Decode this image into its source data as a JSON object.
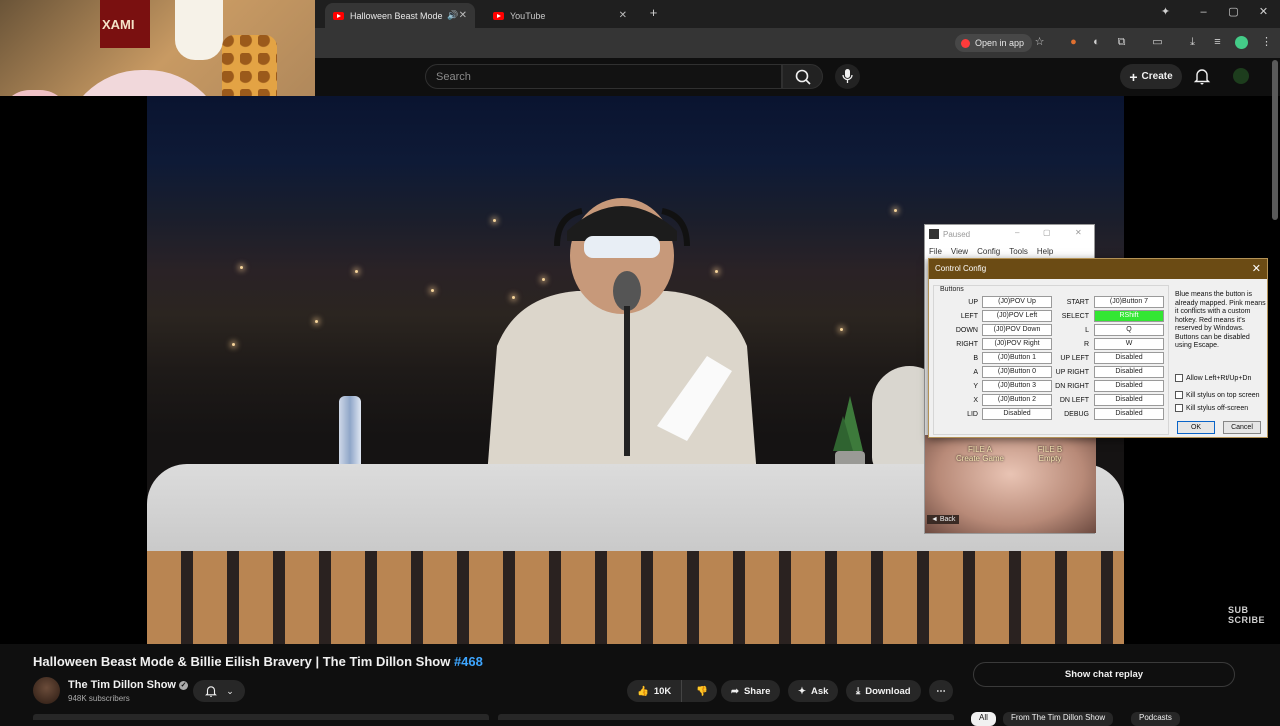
{
  "browser": {
    "tabs": [
      {
        "title": "Halloween Beast Mode & Billie",
        "active": true
      },
      {
        "title": "YouTube",
        "active": false
      }
    ],
    "open_in_app": "Open in app"
  },
  "youtube": {
    "search_placeholder": "Search",
    "create_label": "Create"
  },
  "emulator": {
    "window_title": "Paused",
    "menu": [
      "File",
      "View",
      "Config",
      "Tools",
      "Help"
    ],
    "game": {
      "file_a": "FILE A\nCreate Game",
      "file_b": "FILE B\nEmpty",
      "back": "◄ Back"
    }
  },
  "control_config": {
    "title": "Control Config",
    "group_label": "Buttons",
    "left_column": [
      {
        "label": "UP",
        "value": "(J0)POV Up"
      },
      {
        "label": "LEFT",
        "value": "(J0)POV Left"
      },
      {
        "label": "DOWN",
        "value": "(J0)POV Down"
      },
      {
        "label": "RIGHT",
        "value": "(J0)POV Right"
      },
      {
        "label": "B",
        "value": "(J0)Button 1"
      },
      {
        "label": "A",
        "value": "(J0)Button 0"
      },
      {
        "label": "Y",
        "value": "(J0)Button 3"
      },
      {
        "label": "X",
        "value": "(J0)Button 2"
      },
      {
        "label": "LID",
        "value": "Disabled"
      }
    ],
    "right_column": [
      {
        "label": "START",
        "value": "(J0)Button 7"
      },
      {
        "label": "SELECT",
        "value": "RShift",
        "highlight": "#33e633"
      },
      {
        "label": "L",
        "value": "Q"
      },
      {
        "label": "R",
        "value": "W"
      },
      {
        "label": "UP LEFT",
        "value": "Disabled"
      },
      {
        "label": "UP RIGHT",
        "value": "Disabled"
      },
      {
        "label": "DN RIGHT",
        "value": "Disabled"
      },
      {
        "label": "DN LEFT",
        "value": "Disabled"
      },
      {
        "label": "DEBUG",
        "value": "Disabled"
      }
    ],
    "help_text": "Blue means the button is already mapped. Pink means it conflicts with a custom hotkey. Red means it's reserved by Windows. Buttons can be disabled using Escape.",
    "checkboxes": [
      "Allow Left+Rt/Up+Dn",
      "Kill stylus on top screen",
      "Kill stylus off-screen"
    ],
    "ok_label": "OK",
    "cancel_label": "Cancel"
  },
  "video": {
    "title": "Halloween Beast Mode & Billie Eilish Bravery | The Tim Dillon Show",
    "hashtag": "#468",
    "watermark": "SUB SCRIBE"
  },
  "channel": {
    "name": "The Tim Dillon Show",
    "subscribers": "948K subscribers",
    "verified_icon": "check-circle-icon"
  },
  "actions": {
    "likes": "10K",
    "share": "Share",
    "ask": "Ask",
    "download": "Download",
    "show_chat_replay": "Show chat replay"
  },
  "filters": [
    "All",
    "From The Tim Dillon Show",
    "Podcasts"
  ]
}
